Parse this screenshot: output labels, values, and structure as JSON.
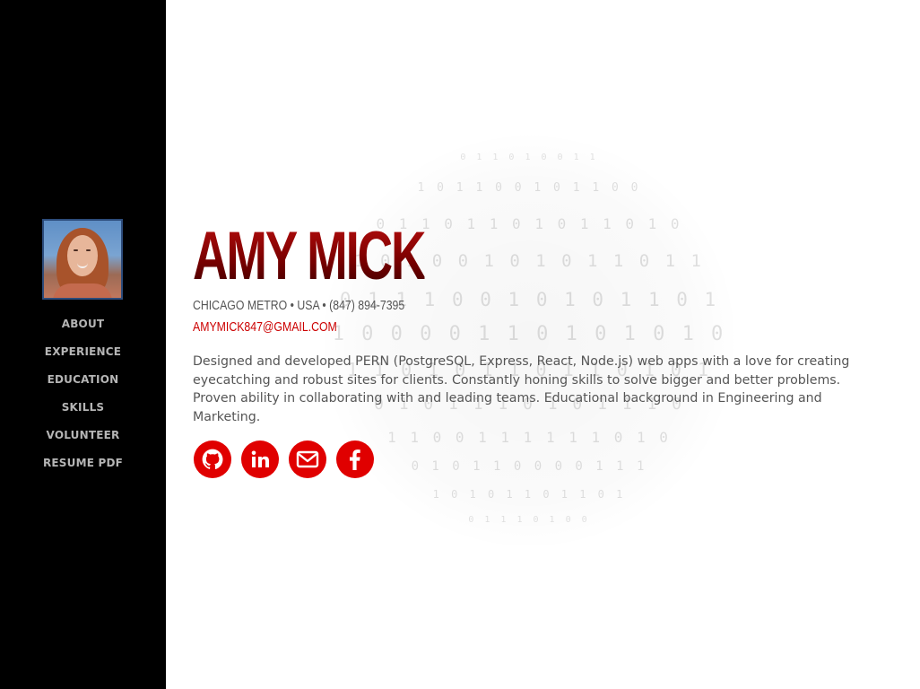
{
  "sidebar": {
    "avatar_alt": "Amy Mick profile photo",
    "nav": [
      {
        "label": "ABOUT"
      },
      {
        "label": "EXPERIENCE"
      },
      {
        "label": "EDUCATION"
      },
      {
        "label": "SKILLS"
      },
      {
        "label": "VOLUNTEER"
      },
      {
        "label": "RESUME PDF"
      }
    ]
  },
  "profile": {
    "name": "AMY MICK",
    "location": "CHICAGO METRO • USA • (847) 894-7395",
    "email": "AMYMICK847@GMAIL.COM",
    "bio": "Designed and developed PERN (PostgreSQL, Express, React, Node.js) web apps with a love for creating eyecatching and robust sites for clients. Constantly honing skills to solve bigger and better problems. Proven ability in collaborating with and leading teams. Educational background in Engineering and Marketing."
  },
  "social": [
    {
      "icon": "github-icon"
    },
    {
      "icon": "linkedin-icon"
    },
    {
      "icon": "email-icon"
    },
    {
      "icon": "facebook-icon"
    }
  ],
  "colors": {
    "sidebar_bg": "#000000",
    "accent": "#e00000",
    "name_dark": "#7a0000",
    "text": "#555555",
    "nav_text": "#b5b5b5"
  }
}
